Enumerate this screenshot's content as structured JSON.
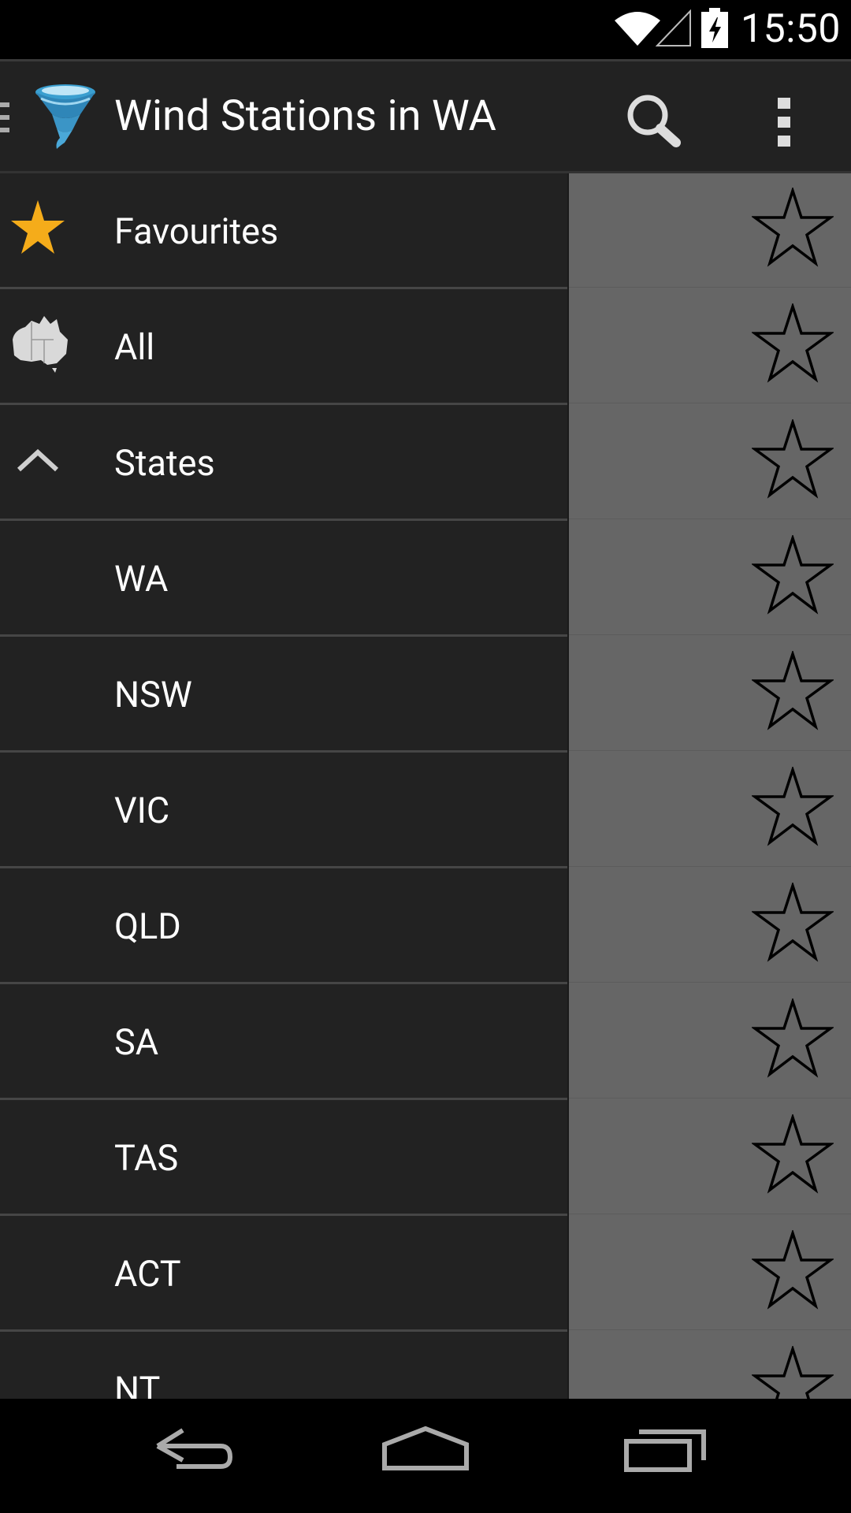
{
  "status_bar": {
    "time": "15:50"
  },
  "action_bar": {
    "title": "Wind Stations in WA"
  },
  "drawer": {
    "items": [
      {
        "label": "Favourites"
      },
      {
        "label": "All"
      },
      {
        "label": "States"
      },
      {
        "label": "WA"
      },
      {
        "label": "NSW"
      },
      {
        "label": "VIC"
      },
      {
        "label": "QLD"
      },
      {
        "label": "SA"
      },
      {
        "label": "TAS"
      },
      {
        "label": "ACT"
      },
      {
        "label": "NT"
      }
    ]
  },
  "colors": {
    "favourite_star": "#f5ac1a",
    "drawer_bg": "#222222",
    "content_bg": "#666666"
  }
}
